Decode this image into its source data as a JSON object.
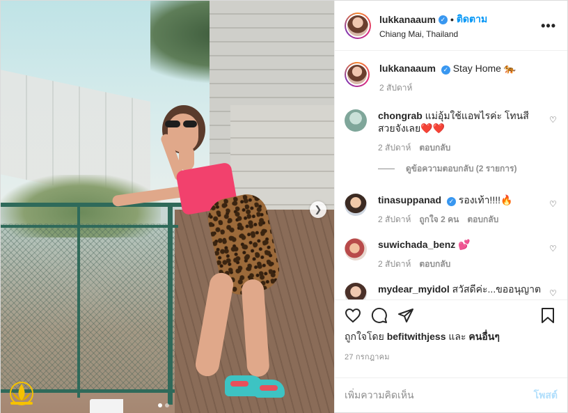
{
  "header": {
    "username": "lukkanaaum",
    "separator": "•",
    "follow_label": "ติดตาม",
    "location": "Chiang Mai, Thailand",
    "more_label": "•••"
  },
  "caption": {
    "username": "lukkanaaum",
    "text": "Stay Home 🐅",
    "time": "2 สัปดาห์"
  },
  "comments": [
    {
      "username": "chongrab",
      "text": "แม่อุ้มใช้แอพไรค่ะ โทนสีสวยจังเลย❤️❤️",
      "time": "2 สัปดาห์",
      "likes": "",
      "reply": "ตอบกลับ",
      "view_replies": "ดูข้อความตอบกลับ (2 รายการ)",
      "verified": false
    },
    {
      "username": "tinasuppanad",
      "text": "รองเท้า!!!!🔥",
      "time": "2 สัปดาห์",
      "likes": "ถูกใจ 2 คน",
      "reply": "ตอบกลับ",
      "verified": true
    },
    {
      "username": "suwichada_benz",
      "text": "💕",
      "time": "2 สัปดาห์",
      "likes": "",
      "reply": "ตอบกลับ",
      "verified": false
    },
    {
      "username": "mydear_myidol",
      "text": "สวัสดีค่ะ...ขออนุญาต",
      "verified": false
    }
  ],
  "likes": {
    "prefix": "ถูกใจโดย",
    "user": "befitwithjess",
    "and": "และ",
    "others": "คนอื่นๆ"
  },
  "post_date": "27 กรกฎาคม",
  "add_comment": {
    "placeholder": "เพิ่มความคิดเห็น",
    "post_label": "โพสต์"
  },
  "colors": {
    "link_blue": "#0095f6",
    "verified_blue": "#3897f0",
    "post_disabled": "#b2dffc",
    "meta_gray": "#8e8e8e"
  },
  "icons": {
    "verified": "verified-badge-icon",
    "more": "more-options-icon",
    "heart": "heart-icon",
    "comment": "comment-icon",
    "share": "share-icon",
    "bookmark": "bookmark-icon",
    "next": "chevron-right-icon"
  },
  "carousel": {
    "slide_count": 2,
    "active_index": 0
  }
}
